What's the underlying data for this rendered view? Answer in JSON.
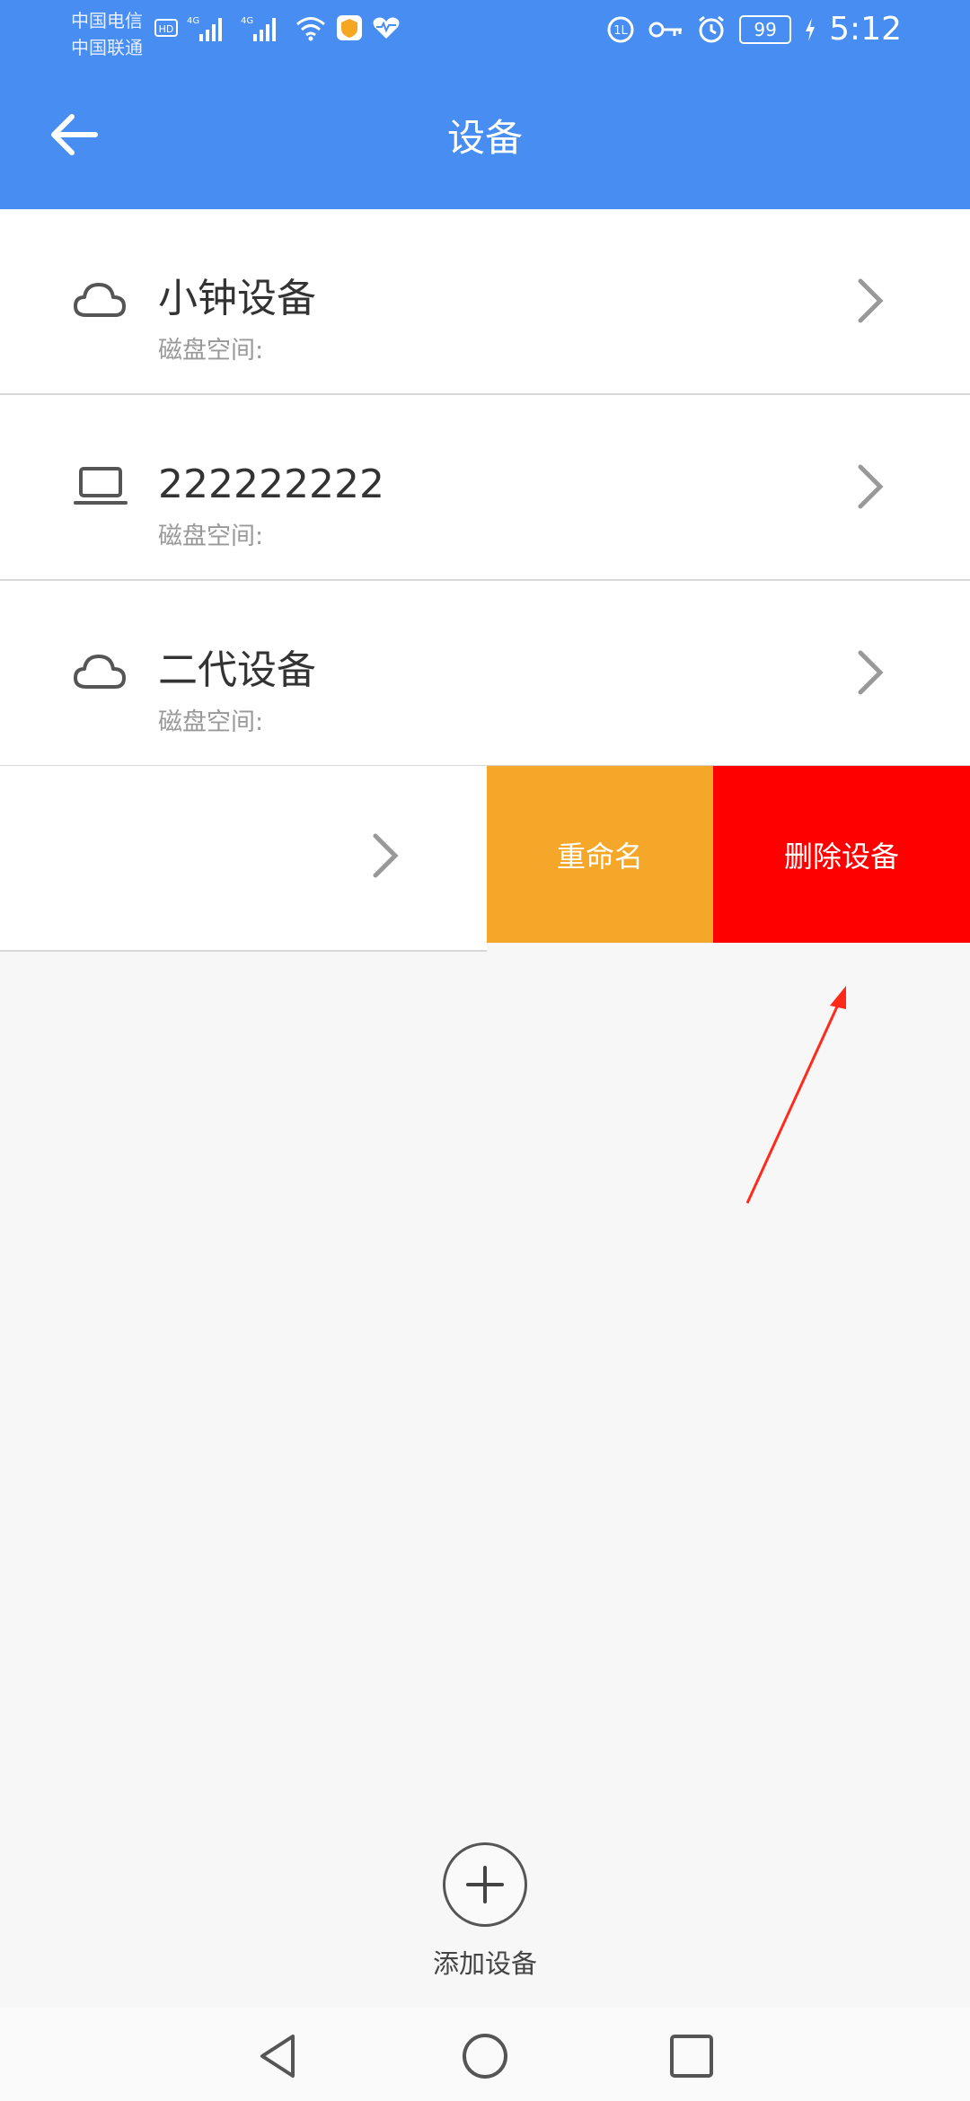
{
  "status_bar": {
    "carrier_1": "中国电信",
    "carrier_2": "中国联通",
    "battery": "99",
    "time": "5:12"
  },
  "header": {
    "title": "设备"
  },
  "devices": [
    {
      "name": "小钟设备",
      "disk_label": "磁盘空间:",
      "icon": "cloud-icon"
    },
    {
      "name": "222222222",
      "disk_label": "磁盘空间:",
      "icon": "laptop-icon"
    },
    {
      "name": "二代设备",
      "disk_label": "磁盘空间:",
      "icon": "cloud-icon"
    }
  ],
  "swipe_actions": {
    "rename": "重命名",
    "delete": "删除设备"
  },
  "add_device": {
    "label": "添加设备"
  },
  "colors": {
    "header": "#478df2",
    "rename": "#f5a72a",
    "delete": "#ff0000",
    "annotation_arrow": "#ff2a1a"
  }
}
